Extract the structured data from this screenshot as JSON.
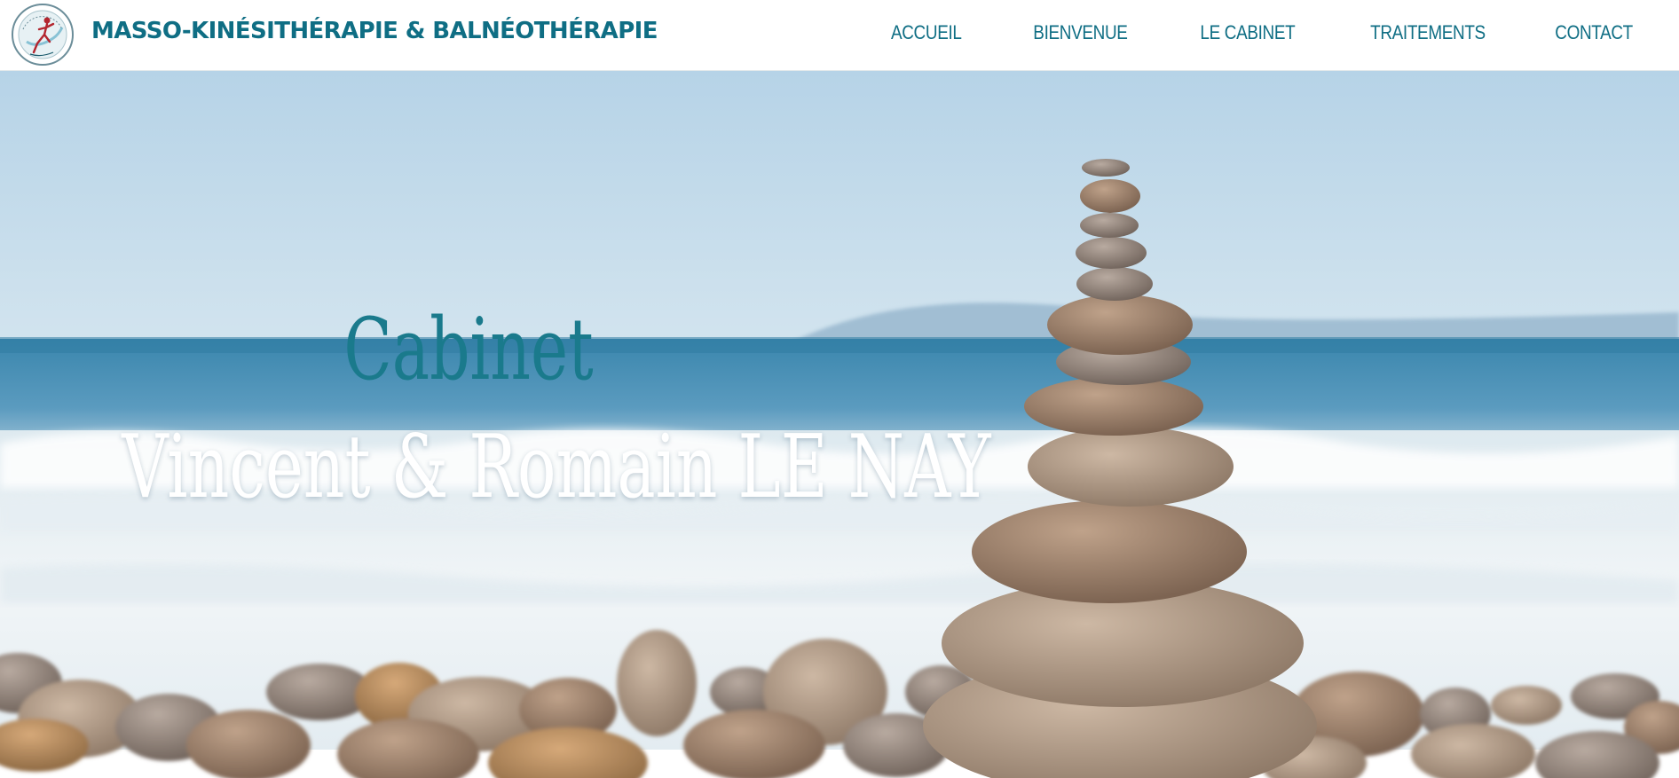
{
  "header": {
    "brand": "MASSO-KINÉSITHÉRAPIE & BALNÉOTHÉRAPIE",
    "logo_icon": "massage-therapy-logo"
  },
  "nav": {
    "items": [
      {
        "label": "ACCUEIL"
      },
      {
        "label": "BIENVENUE"
      },
      {
        "label": "LE CABINET"
      },
      {
        "label": "TRAITEMENTS"
      },
      {
        "label": "CONTACT"
      }
    ]
  },
  "hero": {
    "line1": "Cabinet",
    "line2": "Vincent & Romain LE NAY"
  },
  "colors": {
    "accent": "#0f6e84",
    "headline_teal": "#1a7a8c"
  }
}
